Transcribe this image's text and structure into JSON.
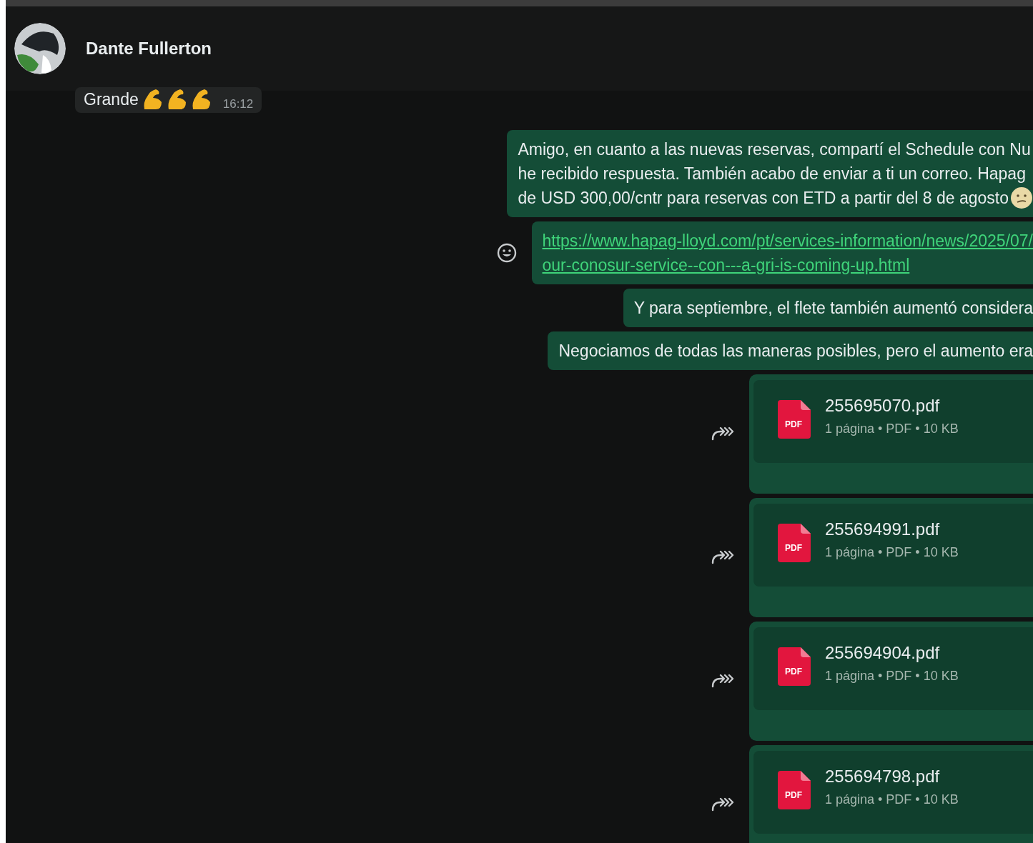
{
  "header": {
    "name": "Dante Fullerton"
  },
  "messages": [
    {
      "kind": "incoming",
      "lines": [
        "Grande"
      ],
      "time": "16:12"
    },
    {
      "kind": "outgoing",
      "lines": [
        "Amigo, en cuanto a las nuevas reservas, compartí el Schedule con Nu",
        "he recibido respuesta. También acabo de enviar a ti un correo. Hapag",
        "de USD 300,00/cntr para reservas con ETD a partir del 8 de agosto"
      ]
    },
    {
      "kind": "link",
      "lines": [
        "https://www.hapag-lloyd.com/pt/services-information/news/2025/07/",
        "our-conosur-service--con---a-gri-is-coming-up.html"
      ]
    },
    {
      "kind": "outgoing",
      "lines": [
        "Y para septiembre, el flete también aumentó considera"
      ]
    },
    {
      "kind": "outgoing",
      "lines": [
        "Negociamos de todas las maneras posibles, pero el aumento era"
      ]
    },
    {
      "kind": "document",
      "icon_label": "PDF",
      "file": "255695070.pdf",
      "meta": "1 página • PDF • 10 KB"
    },
    {
      "kind": "document",
      "icon_label": "PDF",
      "file": "255694991.pdf",
      "meta": "1 página • PDF • 10 KB"
    },
    {
      "kind": "document",
      "icon_label": "PDF",
      "file": "255694904.pdf",
      "meta": "1 página • PDF • 10 KB"
    },
    {
      "kind": "document",
      "icon_label": "PDF",
      "file": "255694798.pdf",
      "meta": "1 página • PDF • 10 KB"
    }
  ]
}
